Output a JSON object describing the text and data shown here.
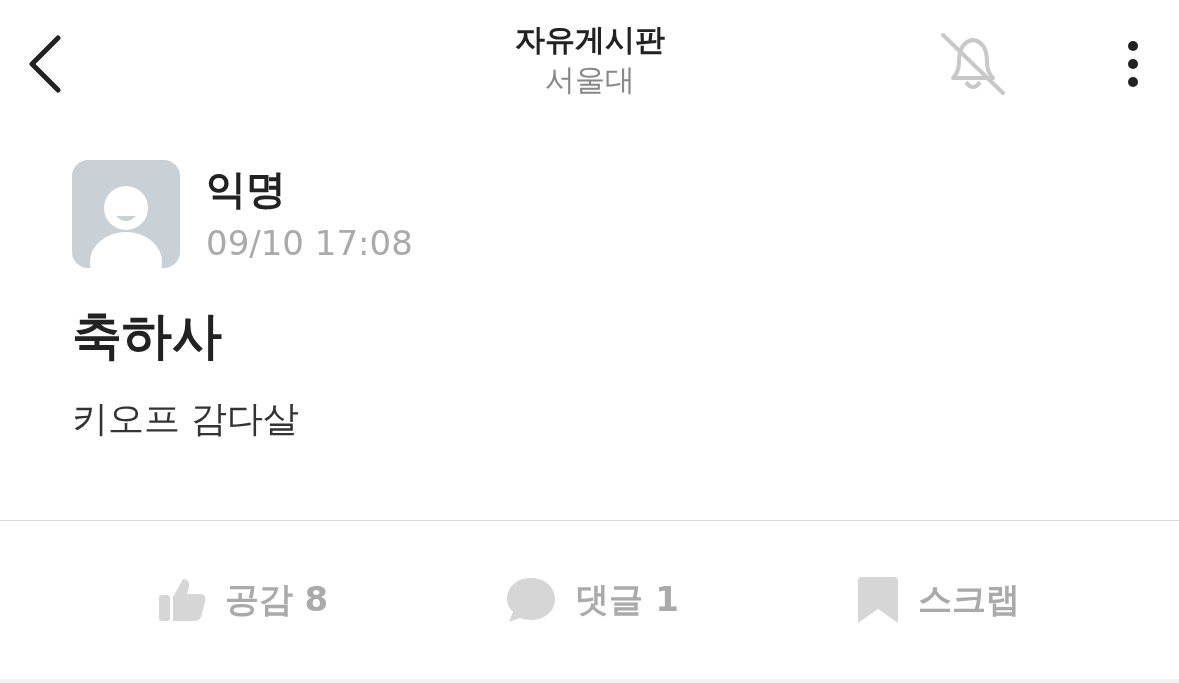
{
  "header": {
    "title": "자유게시판",
    "subtitle": "서울대",
    "notifications_on": false
  },
  "post": {
    "author": "익명",
    "time": "09/10 17:08",
    "title": "축하사",
    "body": "키오프 감다살"
  },
  "actions": [
    {
      "kind": "like",
      "label": "공감 8"
    },
    {
      "kind": "comment",
      "label": "댓글 1"
    },
    {
      "kind": "scrap",
      "label": "스크랩"
    }
  ]
}
